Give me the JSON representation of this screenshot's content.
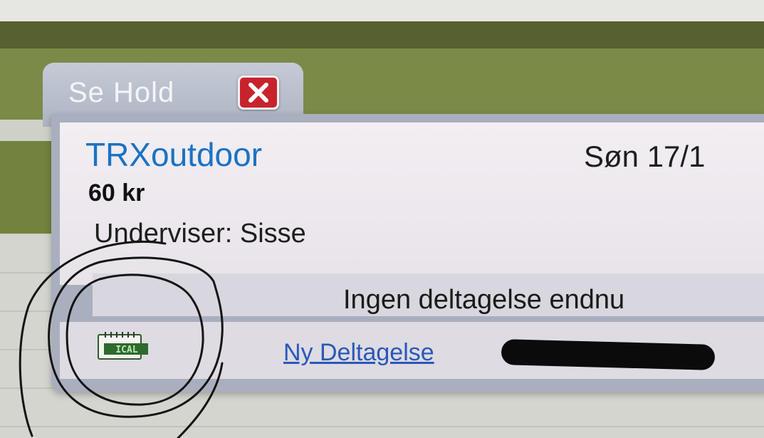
{
  "dialog": {
    "tab_title": "Se Hold",
    "close_glyph": "✕",
    "course_name": "TRXoutdoor",
    "date": "Søn 17/1",
    "date_cutoff": "1",
    "price": "60 kr",
    "teacher": "Underviser: Sisse",
    "status": "Ingen deltagelse endnu",
    "new_participation_link": "Ny Deltagelse",
    "ical_label": "ICAL"
  },
  "icons": {
    "close": "close-icon",
    "ical": "calendar-icon"
  },
  "colors": {
    "course_link": "#1b72c2",
    "close_button": "#c8232c",
    "dialog_frame": "#a9afbe",
    "header_green": "#56612f"
  }
}
